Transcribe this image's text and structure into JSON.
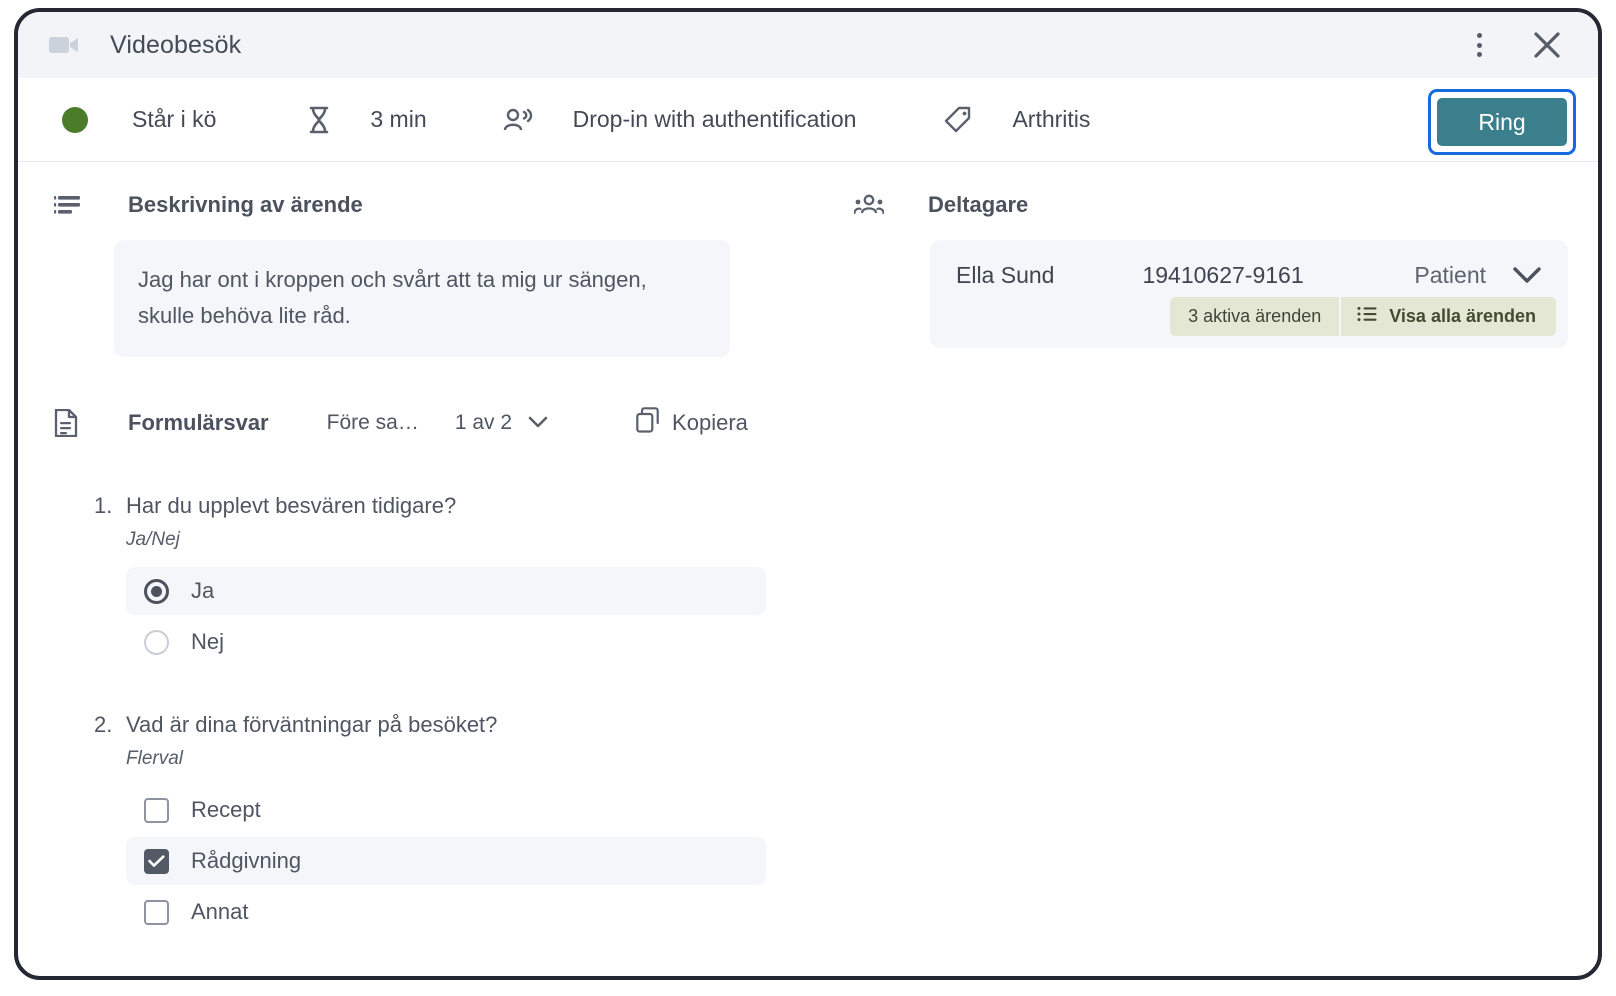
{
  "window": {
    "title": "Videobesök",
    "video_icon": "video-camera-icon",
    "menu_icon": "kebab-menu-icon",
    "close_icon": "close-icon"
  },
  "status": {
    "dot_color": "#4a7c2a",
    "state": "Står i kö",
    "wait_icon": "hourglass-icon",
    "wait_time": "3 min",
    "type_icon": "people-icon",
    "type": "Drop-in with authentification",
    "tag_icon": "tag-icon",
    "tag": "Arthritis",
    "call_button": "Ring",
    "call_button_color": "#3c7f8c",
    "focus_ring_color": "#1769e0"
  },
  "description": {
    "icon": "text-lines-icon",
    "title": "Beskrivning av ärende",
    "text": "Jag har ont i kroppen och svårt att ta mig ur sängen, skulle behöva lite råd."
  },
  "participants": {
    "icon": "people-group-icon",
    "title": "Deltagare",
    "rows": [
      {
        "name": "Ella Sund",
        "personal_id": "19410627-9161",
        "role": "Patient",
        "chevron_icon": "chevron-down-icon",
        "active_cases_badge": "3 aktiva ärenden",
        "show_all_icon": "list-icon",
        "show_all_label": "Visa alla ärenden",
        "badge_bg": "#e3e7d4"
      }
    ]
  },
  "form": {
    "icon": "document-icon",
    "title": "Formulärsvar",
    "filter_value": "Före sa…",
    "pager_value": "1 av 2",
    "pager_chevron_icon": "chevron-down-icon",
    "copy_icon": "copy-icon",
    "copy_label": "Kopiera",
    "questions": [
      {
        "number": "1.",
        "text": "Har du upplevt besvären tidigare?",
        "type_label": "Ja/Nej",
        "control": "radio",
        "options": [
          {
            "label": "Ja",
            "selected": true
          },
          {
            "label": "Nej",
            "selected": false
          }
        ]
      },
      {
        "number": "2.",
        "text": "Vad är dina förväntningar på besöket?",
        "type_label": "Flerval",
        "control": "checkbox",
        "options": [
          {
            "label": "Recept",
            "selected": false
          },
          {
            "label": "Rådgivning",
            "selected": true
          },
          {
            "label": "Annat",
            "selected": false
          }
        ]
      }
    ]
  }
}
